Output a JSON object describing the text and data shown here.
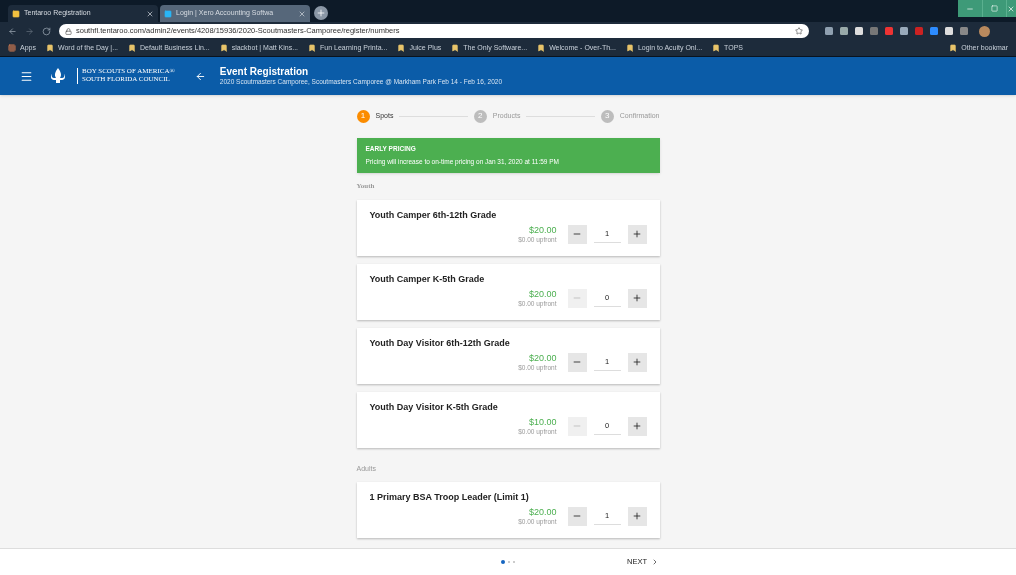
{
  "browser": {
    "tabs": [
      {
        "title": "Tentaroo Registration",
        "selected": true
      },
      {
        "title": "Login | Xero Accounting Softwa",
        "selected": false
      }
    ],
    "address": "southfl.tentaroo.com/admin2/events/4208/15936/2020-Scoutmasters-Camporee/register/numbers",
    "bookmarks": [
      {
        "label": "Apps"
      },
      {
        "label": "Word of the Day |..."
      },
      {
        "label": "Default Business Lin..."
      },
      {
        "label": "slackbot | Matt Kins..."
      },
      {
        "label": "Fun Learning Printa..."
      },
      {
        "label": "Juice Plus"
      },
      {
        "label": "The Only Software..."
      },
      {
        "label": "Welcome - Over-Th..."
      },
      {
        "label": "Login to Acuity Onl..."
      },
      {
        "label": "TOPS"
      }
    ],
    "other_bookmarks": "Other bookmar"
  },
  "header": {
    "org_line_1": "BOY SCOUTS OF AMERICA®",
    "org_line_2": "SOUTH FLORIDA COUNCIL",
    "title": "Event Registration",
    "subtitle": "2020 Scoutmasters Camporee, Scoutmasters Camporee @ Markham Park Feb 14 - Feb 16, 2020"
  },
  "steps": [
    {
      "number": "1",
      "label": "Spots",
      "selected": true
    },
    {
      "number": "2",
      "label": "Products",
      "selected": false
    },
    {
      "number": "3",
      "label": "Confirmation",
      "selected": false
    }
  ],
  "notice": {
    "title": "EARLY PRICING",
    "text": "Pricing will increase to on-time pricing on Jan 31, 2020 at 11:59 PM"
  },
  "sections": [
    {
      "heading": "Youth",
      "items": [
        {
          "name": "Youth Camper 6th-12th Grade",
          "price": "$20.00",
          "upfront": "$0.00 upfront",
          "quantity": "1",
          "minus_disabled": false
        },
        {
          "name": "Youth Camper K-5th Grade",
          "price": "$20.00",
          "upfront": "$0.00 upfront",
          "quantity": "0",
          "minus_disabled": true
        },
        {
          "name": "Youth Day Visitor 6th-12th Grade",
          "price": "$20.00",
          "upfront": "$0.00 upfront",
          "quantity": "1",
          "minus_disabled": false
        },
        {
          "name": "Youth Day Visitor K-5th Grade",
          "price": "$10.00",
          "upfront": "$0.00 upfront",
          "quantity": "0",
          "minus_disabled": true
        }
      ]
    },
    {
      "heading": "Adults",
      "items": [
        {
          "name": "1 Primary BSA Troop Leader (Limit 1)",
          "price": "$20.00",
          "upfront": "$0.00 upfront",
          "quantity": "1",
          "minus_disabled": false
        }
      ]
    }
  ],
  "pager": {
    "dots": [
      {
        "selected": true
      },
      {
        "selected": false
      },
      {
        "selected": false
      }
    ],
    "next": "NEXT"
  }
}
